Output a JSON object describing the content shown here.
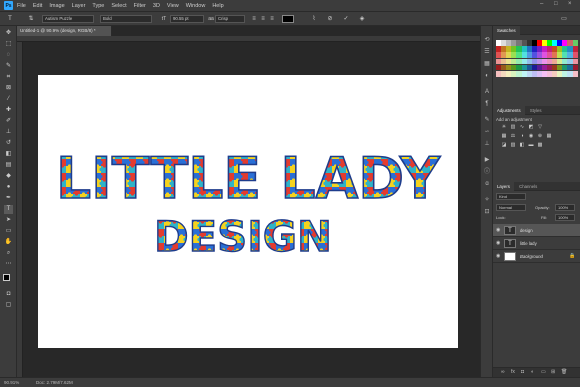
{
  "menu": {
    "app_icon": "Ps",
    "items": [
      "File",
      "Edit",
      "Image",
      "Layer",
      "Type",
      "Select",
      "Filter",
      "3D",
      "View",
      "Window",
      "Help"
    ],
    "window_controls": [
      "–",
      "□",
      "×"
    ]
  },
  "options": {
    "font_family": "Autism Puzzle",
    "font_style": "Bold",
    "font_size": "90.55 pt",
    "anti_alias": "Crisp",
    "color_swatch": "#000000"
  },
  "document": {
    "tab_label": "Untitled-1 @ 90.9% (design, RGB/8) *",
    "line1": "LITTLE LADY",
    "line2": "DESIGN"
  },
  "status": {
    "zoom": "90.91%",
    "doc_info": "Doc: 2.79M/7.62M"
  },
  "panels": {
    "swatches_tab": "Swatches",
    "adjustments_tab": "Adjustments",
    "styles_tab": "Styles",
    "add_adjustment": "Add an adjustment",
    "layers_tab": "Layers",
    "channels_tab": "Channels",
    "kind_label": "Kind",
    "blend_mode": "Normal",
    "opacity_label": "Opacity:",
    "opacity_value": "100%",
    "lock_label": "Lock:",
    "fill_label": "Fill:",
    "fill_value": "100%",
    "layers": [
      {
        "name": "design",
        "type": "text",
        "selected": true
      },
      {
        "name": "little lady",
        "type": "text",
        "selected": false
      },
      {
        "name": "Background",
        "type": "bg",
        "selected": false
      }
    ]
  },
  "colors": {
    "accent": "#31a8ff",
    "letter_outline": "#1e3c8c",
    "puzzle_red": "#e33b2e",
    "puzzle_yellow": "#f5d21e",
    "puzzle_blue": "#2a6fd6",
    "puzzle_teal": "#2fb3c7"
  }
}
